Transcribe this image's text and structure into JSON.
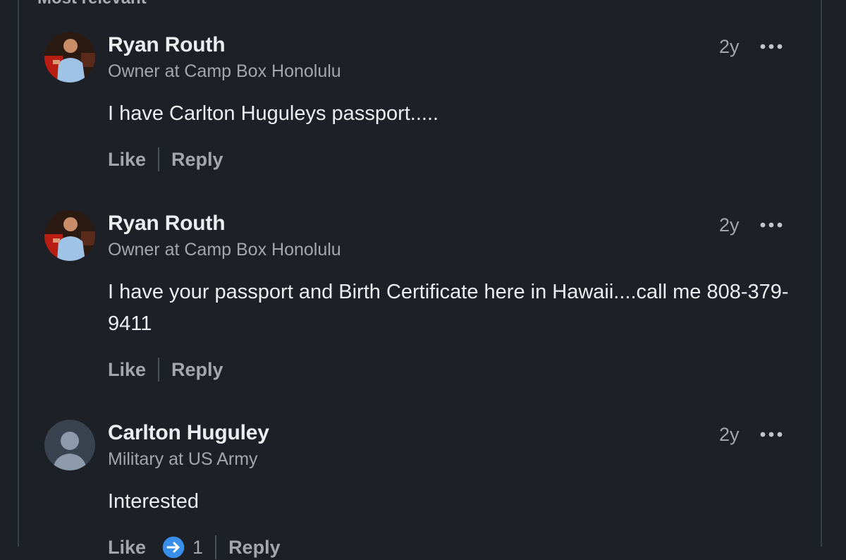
{
  "section": {
    "heading": "Most relevant"
  },
  "comments": [
    {
      "author": "Ryan Routh",
      "headline": "Owner at Camp Box Honolulu",
      "time": "2y",
      "more_icon": "ellipsis-icon",
      "body": "I have Carlton Huguleys passport.....",
      "like_label": "Like",
      "reply_label": "Reply"
    },
    {
      "author": "Ryan Routh",
      "headline": "Owner at Camp Box Honolulu",
      "time": "2y",
      "more_icon": "ellipsis-icon",
      "body": "I have your passport and Birth Certificate here in Hawaii....call me 808-379-9411",
      "like_label": "Like",
      "reply_label": "Reply"
    },
    {
      "author": "Carlton Huguley",
      "headline": "Military at US Army",
      "time": "2y",
      "more_icon": "ellipsis-icon",
      "body": "Interested",
      "like_label": "Like",
      "reaction_icon": "celebrate-icon",
      "reaction_count": "1",
      "reply_label": "Reply"
    }
  ],
  "colors": {
    "background": "#1d2026",
    "primary_text": "#ebedf0",
    "secondary_text": "#a3a7ad",
    "divider": "#4c5058",
    "reaction_blue": "#378fe9"
  }
}
